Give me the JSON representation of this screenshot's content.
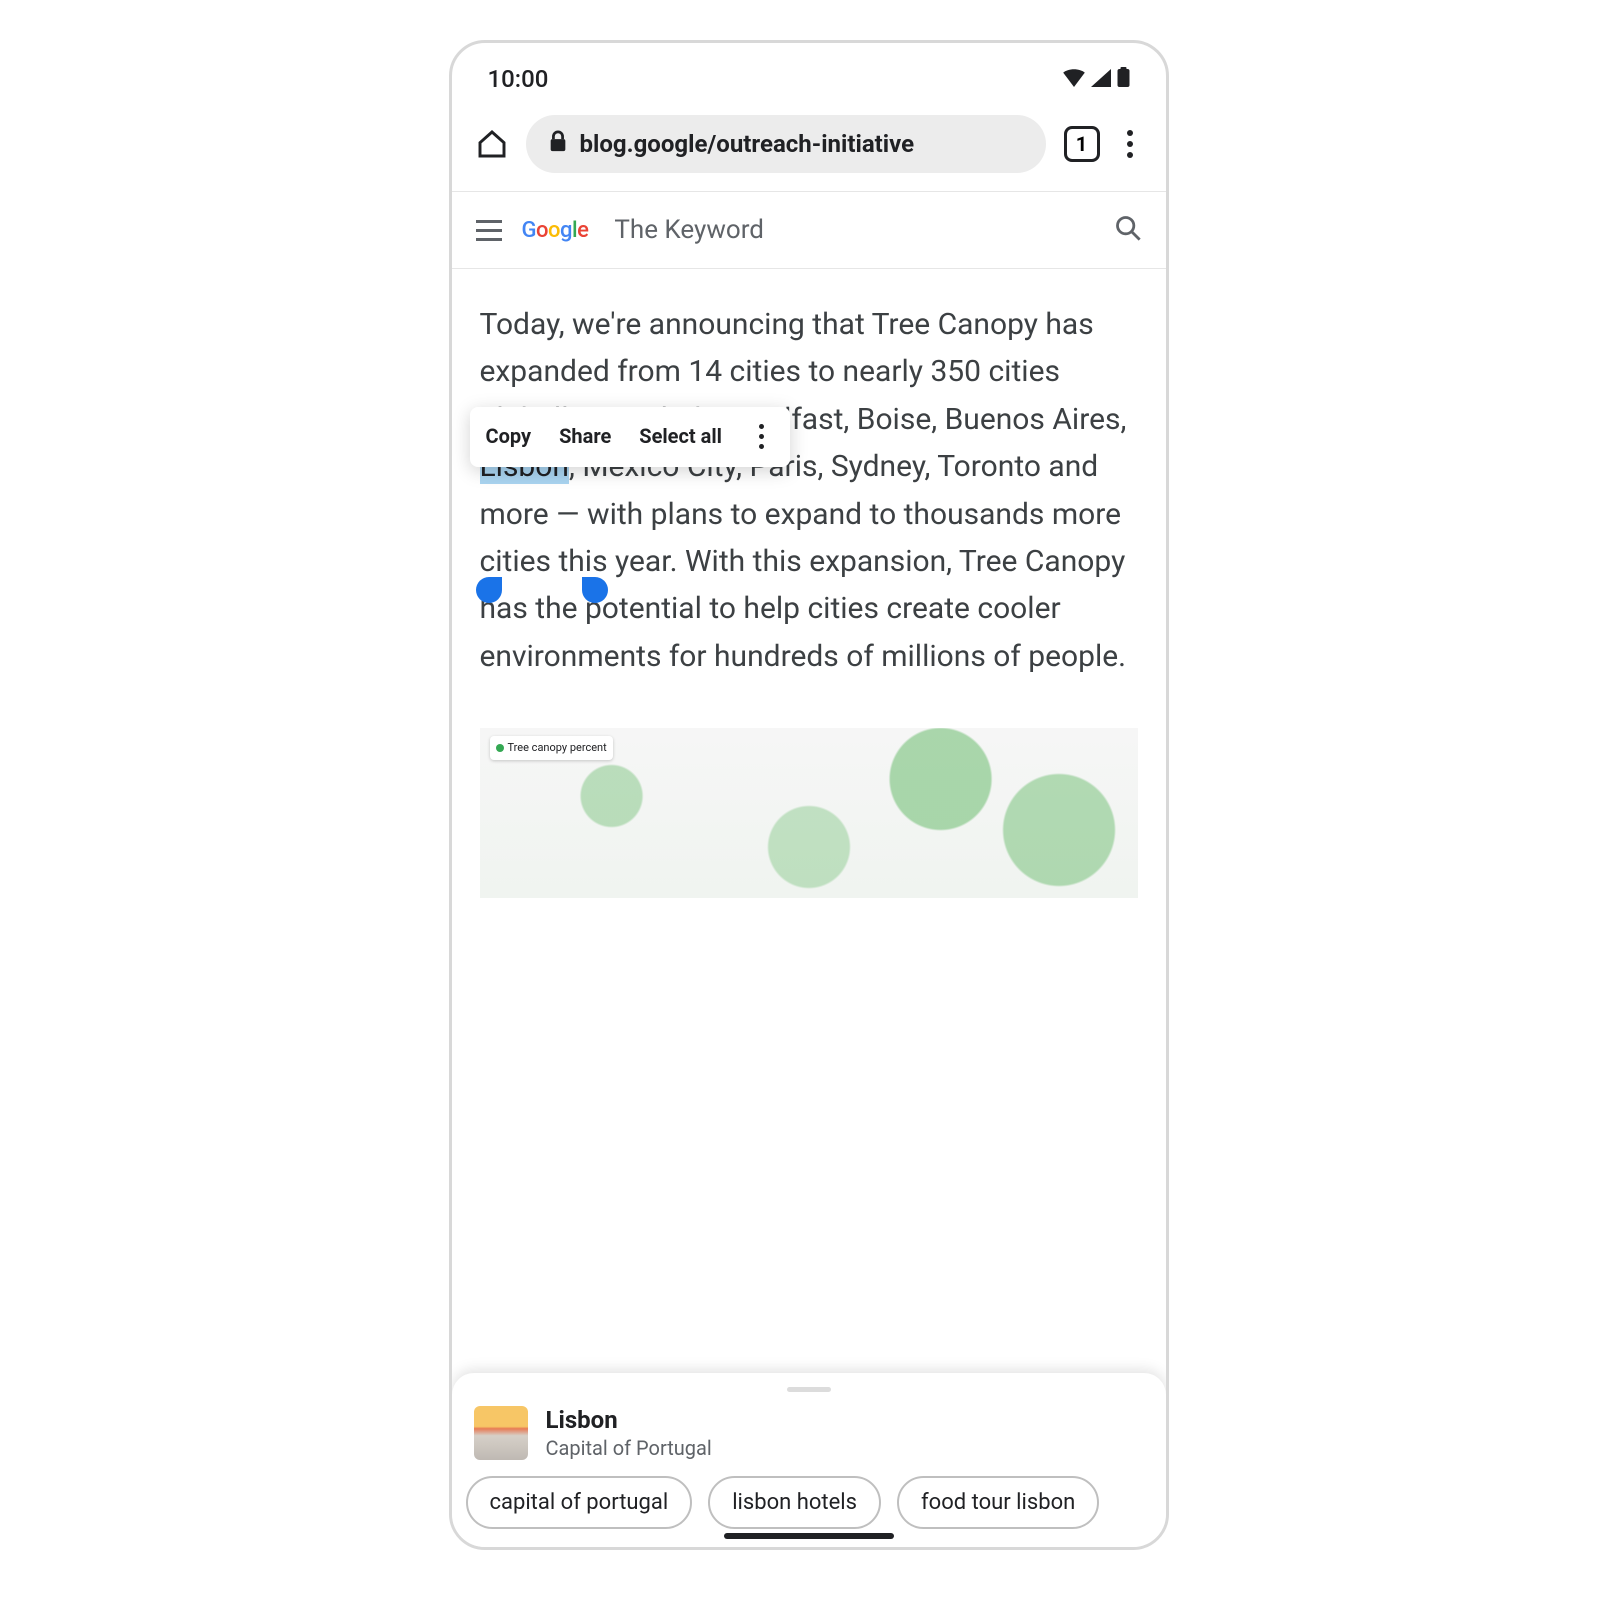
{
  "status": {
    "time": "10:00"
  },
  "browser": {
    "url": "blog.google/outreach-initiative",
    "tab_count": "1"
  },
  "blog": {
    "brand": "The Keyword"
  },
  "article": {
    "pre": "Today, we're announcing that Tree Canopy has expanded from 14 cities to nearly 350 cities globally — including Belfast, Boise, Buenos Aires, ",
    "selected": "Lisbon",
    "post": ", Mexico City, Paris, Sydney, Toronto and more — with plans to expand to thousands more cities this year. With this expansion, Tree Canopy has the potential to help cities create cooler environments for hundreds of millions of people."
  },
  "context_menu": {
    "copy": "Copy",
    "share": "Share",
    "select_all": "Select all"
  },
  "map": {
    "legend": "Tree canopy percent"
  },
  "sheet": {
    "title": "Lisbon",
    "subtitle": "Capital of Portugal",
    "chips": [
      "capital of portugal",
      "lisbon hotels",
      "food tour lisbon"
    ]
  }
}
